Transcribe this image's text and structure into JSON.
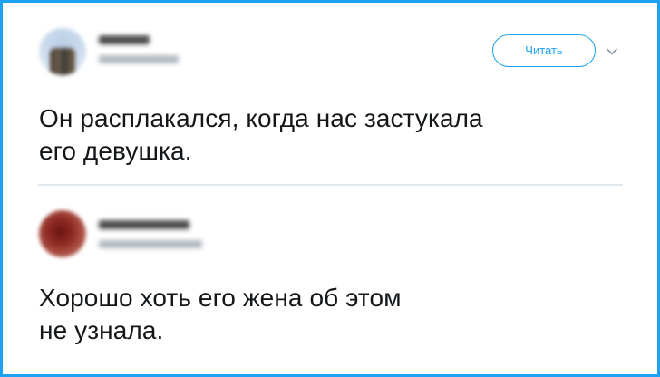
{
  "tweets": [
    {
      "follow_label": "Читать",
      "text_lines": [
        "Он расплакался, когда нас застукала",
        "его девушка."
      ]
    },
    {
      "text_lines": [
        "Хорошо хоть его жена об этом",
        "не узнала."
      ]
    }
  ],
  "icons": {
    "caret": "chevron-down-icon"
  },
  "colors": {
    "accent": "#1da1f2",
    "text": "#14171a",
    "divider": "#e1e8ed",
    "caret": "#8899a6"
  }
}
